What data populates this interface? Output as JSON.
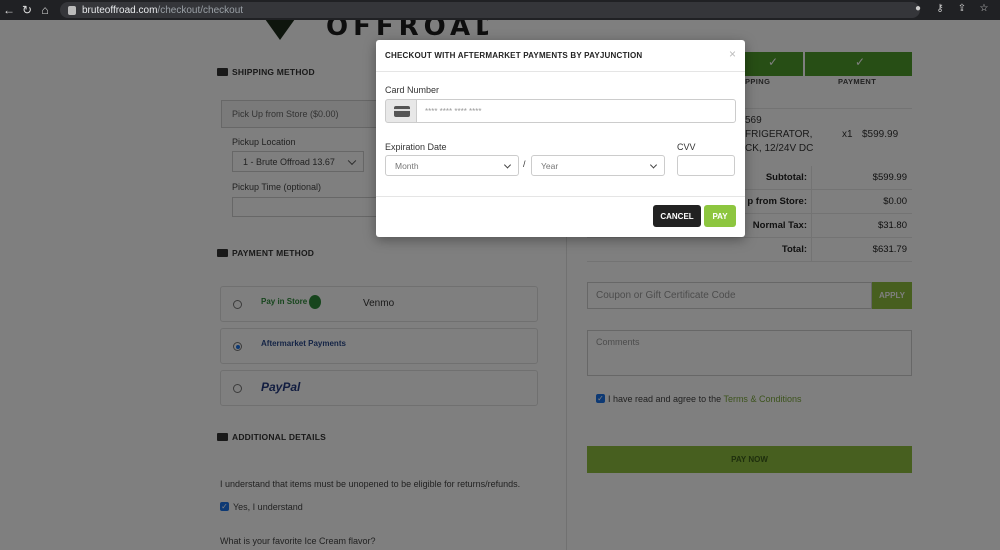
{
  "browser": {
    "url_host": "bruteoffroad.com",
    "url_path": "/checkout/checkout"
  },
  "site": {
    "logo_text": "OFFROAD"
  },
  "shipping": {
    "title": "SHIPPING METHOD",
    "method_value": "Pick Up from Store ($0.00)",
    "pickup_location_label": "Pickup Location",
    "pickup_location_value": "1 - Brute Offroad 13.67",
    "pickup_time_label": "Pickup Time (optional)"
  },
  "payment": {
    "title": "PAYMENT METHOD",
    "options": [
      {
        "brand": "Pay in Store",
        "name": "Venmo",
        "checked": false
      },
      {
        "brand": "Aftermarket Payments",
        "name": "",
        "checked": true
      },
      {
        "brand": "PayPal",
        "name": "",
        "checked": false
      }
    ]
  },
  "additional": {
    "title": "ADDITIONAL DETAILS",
    "returns_notice": "I understand that items must be unopened to be eligible for returns/refunds.",
    "understand_label": "Yes, I understand",
    "ice_cream_question": "What is your favorite Ice Cream flavor?"
  },
  "steps": {
    "shipping_label": "SHIPPING",
    "shipping_partial": "PPING",
    "payment_label": "PAYMENT"
  },
  "cart": {
    "item_line1": "569",
    "item_line2": "FRIGERATOR,",
    "item_line3": "CK, 12/24V DC",
    "qty": "x1",
    "price": "$599.99"
  },
  "summary": [
    {
      "label": "Subtotal:",
      "value": "$599.99"
    },
    {
      "label": "p from Store:",
      "value": "$0.00"
    },
    {
      "label": "Normal Tax:",
      "value": "$31.80"
    },
    {
      "label": "Total:",
      "value": "$631.79"
    }
  ],
  "coupon": {
    "placeholder": "Coupon or Gift Certificate Code",
    "apply_label": "APPLY"
  },
  "comments": {
    "placeholder": "Comments"
  },
  "terms": {
    "text": "I have read and agree to the ",
    "link": "Terms & Conditions"
  },
  "pay_now_label": "PAY NOW",
  "modal": {
    "title": "CHECKOUT WITH AFTERMARKET PAYMENTS BY PAYJUNCTION",
    "close_glyph": "×",
    "card_number_label": "Card Number",
    "card_number_placeholder": "**** **** **** ****",
    "expiration_label": "Expiration Date",
    "month_placeholder": "Month",
    "year_placeholder": "Year",
    "slash": "/",
    "cvv_label": "CVV",
    "cancel_label": "CANCEL",
    "pay_label": "PAY"
  },
  "colors": {
    "accent_green": "#8dc63f",
    "step_green": "#4f9d2b",
    "dark": "#222222"
  }
}
